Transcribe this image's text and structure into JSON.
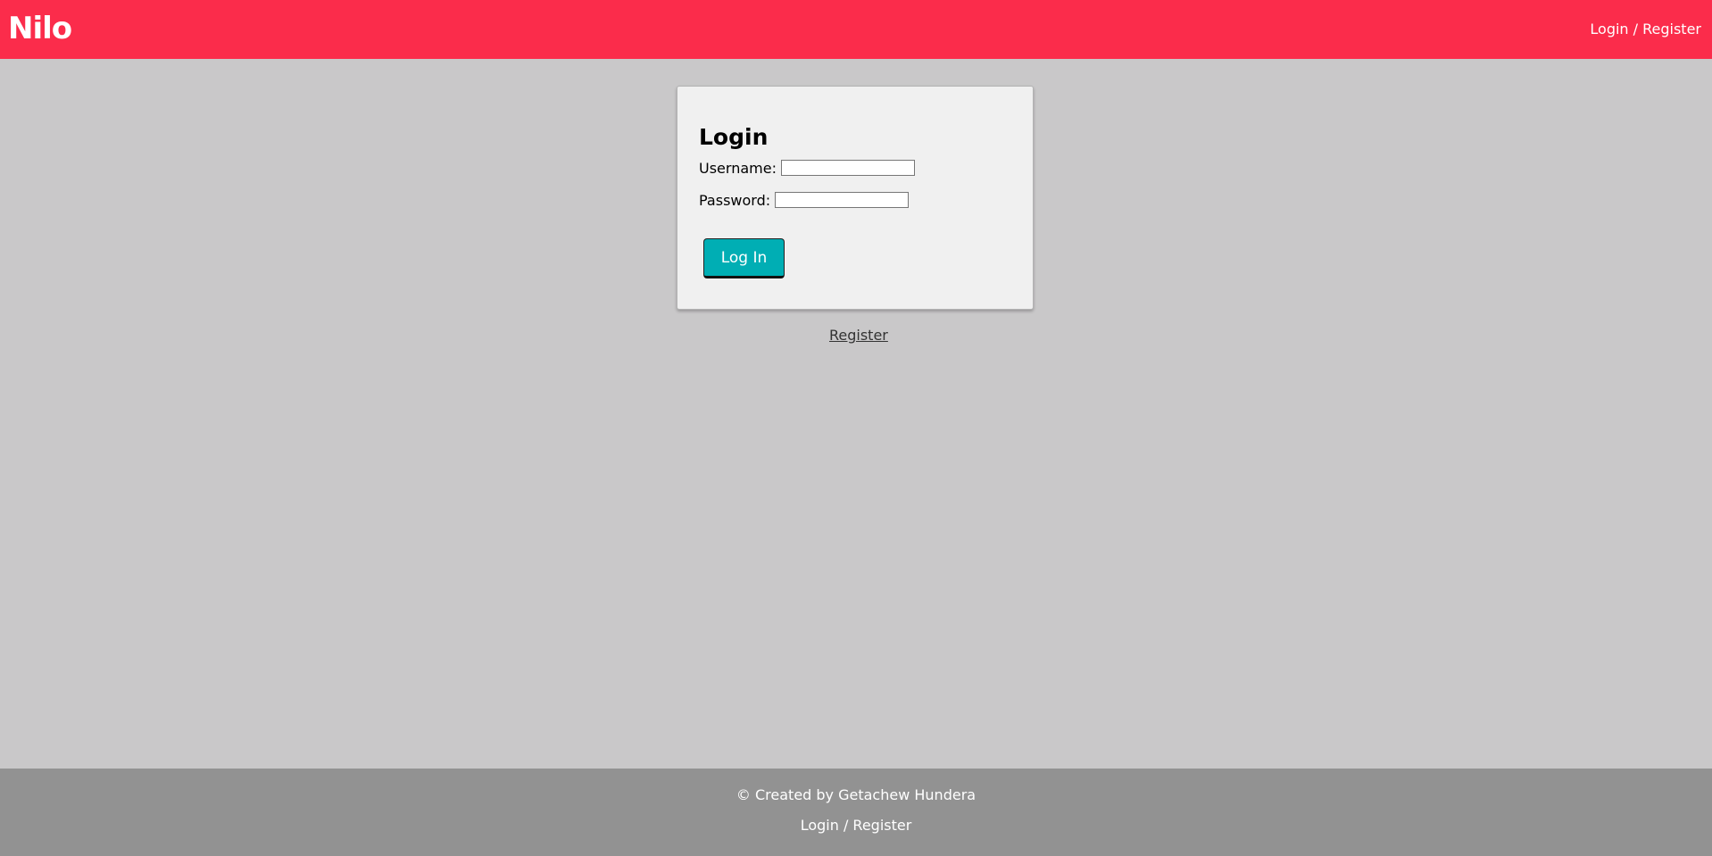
{
  "header": {
    "logo_text": "Nilo",
    "auth_link": "Login / Register",
    "background_color": "#fb2c4b"
  },
  "login_form": {
    "title": "Login",
    "username_label": "Username:",
    "username_value": "",
    "password_label": "Password:",
    "password_value": "",
    "submit_label": "Log In",
    "submit_color": "#00aeb4"
  },
  "register_link": "Register",
  "footer": {
    "credit": "© Created by Getachew Hundera",
    "auth_link": "Login / Register",
    "background_color": "#929292"
  },
  "page_background": "#c9c8c9"
}
